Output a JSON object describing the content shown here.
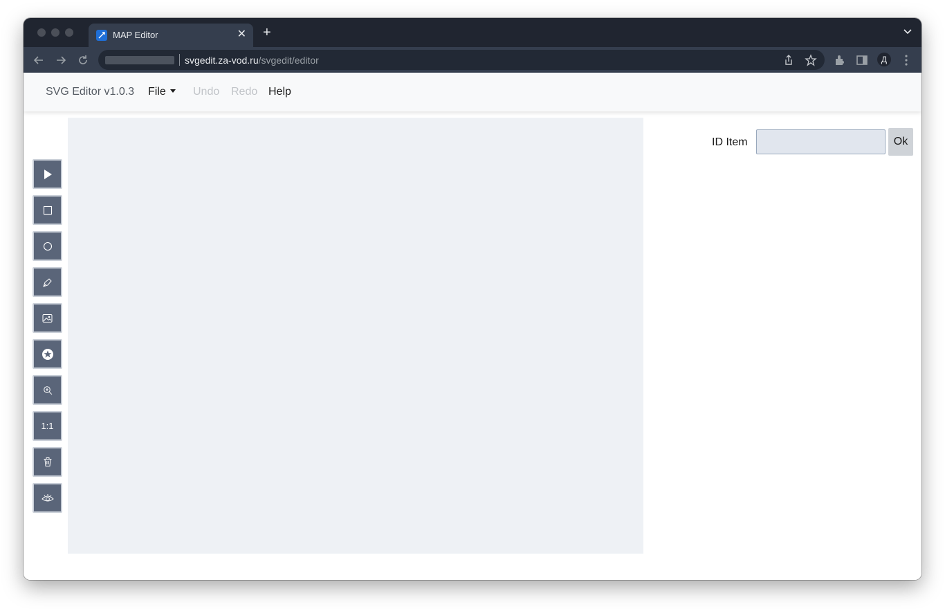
{
  "browser": {
    "tab_title": "MAP Editor",
    "url_host": "svgedit.za-vod.ru",
    "url_path": "/svgedit/editor",
    "profile_initial": "Д"
  },
  "navbar": {
    "brand": "SVG Editor v1.0.3",
    "file": "File",
    "undo": "Undo",
    "redo": "Redo",
    "help": "Help"
  },
  "tools": [
    {
      "name": "select",
      "icon": "pointer-icon"
    },
    {
      "name": "rectangle",
      "icon": "square-icon"
    },
    {
      "name": "circle",
      "icon": "circle-icon"
    },
    {
      "name": "path",
      "icon": "pen-icon"
    },
    {
      "name": "image",
      "icon": "image-icon"
    },
    {
      "name": "star",
      "icon": "star-badge-icon"
    },
    {
      "name": "zoom",
      "icon": "zoom-in-icon"
    },
    {
      "name": "actual-size",
      "label": "1:1"
    },
    {
      "name": "delete",
      "icon": "trash-icon"
    },
    {
      "name": "preview",
      "icon": "eye-icon"
    }
  ],
  "id_panel": {
    "label": "ID Item",
    "value": "",
    "ok": "Ok"
  }
}
